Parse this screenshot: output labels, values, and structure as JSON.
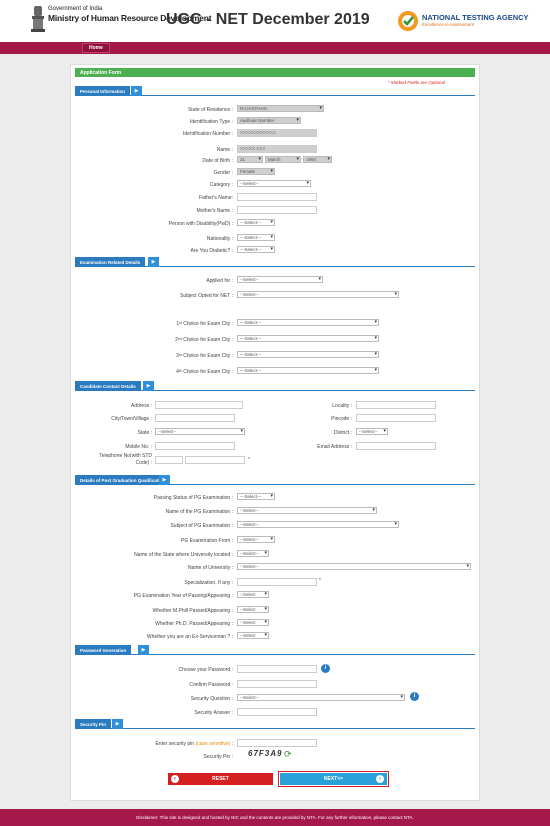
{
  "header": {
    "gov_line1": "Government of India",
    "gov_line2": "Ministry of Human Resource Development",
    "title": "UGC - NET December 2019",
    "nta_title": "NATIONAL TESTING AGENCY",
    "nta_tagline": "Excellence in Assessment"
  },
  "nav": {
    "home": "Home"
  },
  "form": {
    "title": "Application Form",
    "mandatory_note": "* Marked Fields are Optional"
  },
  "sections": {
    "personal": "Personal Information",
    "exam": "Examination Related Details",
    "contact": "Candidate Contact Details",
    "pg": "Details of Post Graduation Qualification",
    "password": "Password Generation",
    "pin": "Security Pin"
  },
  "personal": {
    "state_label": "State of Residence :",
    "state_value": "RAJASTHAN",
    "idtype_label": "Identification Type :",
    "idtype_value": "Aadhaar Number",
    "idnum_label": "Identification Number :",
    "idnum_value": "XXXXXXXXXXXX",
    "name_label": "Name :",
    "name_value": "XXXXX XXX",
    "dob_label": "Date of Birth :",
    "dob_day": "31",
    "dob_month": "March",
    "dob_year": "1994",
    "gender_label": "Gender :",
    "gender_value": "Female",
    "category_label": "Category :",
    "category_value": "--Select--",
    "father_label": "Father's Name:",
    "mother_label": "Mother's Name :",
    "pwd_label": "Person with Disability(PwD) :",
    "pwd_value": "---Select---",
    "nationality_label": "Nationality :",
    "nationality_value": "---Select---",
    "diabetic_label": "Are You Diabetic? :",
    "diabetic_value": "---Select---"
  },
  "exam": {
    "applied_label": "Applied for :",
    "applied_value": "--Select--",
    "subject_label": "Subject Opted for NET :",
    "subject_value": "--Select--",
    "choice1": "Choice for Exam City :",
    "choice2": "Choice for Exam City :",
    "choice3": "Choice for Exam City :",
    "choice4": "Choice for Exam City :",
    "n1": "1",
    "n2": "2",
    "n3": "3",
    "n4": "4",
    "sup1": "st",
    "sup2": "nd",
    "sup3": "rd",
    "sup4": "th",
    "city_value": "---Select---"
  },
  "contact": {
    "address_label": "Address :",
    "locality_label": "Locality :",
    "city_label": "City/Town/Village :",
    "pincode_label": "Pincode :",
    "state_label": "State :",
    "state_value": "--Select--",
    "district_label": "District :",
    "district_value": "--Select--",
    "mobile_label": "Mobile No. :",
    "email_label": "Email Address :",
    "tel_label1": "Telephone No(with STD",
    "tel_label2": "Code) :"
  },
  "pg": {
    "status_label": "Passing Status of PG Examination :",
    "status_value": "---Select---",
    "name_label": "Name of the PG Examination :",
    "name_value": "--Select--",
    "subject_label": "Subject of PG Examination :",
    "subject_value": "--Select--",
    "from_label": "PG Examination From :",
    "from_value": "--Select--",
    "univstate_label": "Name of the State where University located :",
    "univstate_value": "--Select--",
    "univ_label": "Name of University :",
    "univ_value": "--Select--",
    "spec_label": "Specialization, If any :",
    "year_label": "PG Examination Year of Passing/Appearing :",
    "year_value": "--Select",
    "mphil_label": "Whether M.Phill Passed/Appearing :",
    "mphil_value": "--Select",
    "phd_label": "Whether Ph.D. Passed/Appearing :",
    "phd_value": "--Select",
    "ex_label": "Whether you are an Ex-Serviceman ? :",
    "ex_value": "--Select"
  },
  "password": {
    "choose_label": "Choose your Password :",
    "confirm_label": "Confirm Password :",
    "question_label": "Security Question :",
    "question_value": "--Select--",
    "answer_label": "Security Answer :"
  },
  "pin": {
    "enter_label": "Enter security pin ",
    "case_note": "(case sensitive)",
    "enter_colon": " :",
    "pin_label": "Security Pin :",
    "captcha": "67F3A9"
  },
  "buttons": {
    "reset": "RESET",
    "next": "NEXT>>"
  },
  "footer": "Disclaimer: This site is designed and hosted by NIC and the contents are provided by NTA. For any further information, please contact NTA.",
  "colors": {
    "header_band": "#a4184a",
    "form_title": "#4caf50",
    "section": "#2a7bbf",
    "reset": "#d42020",
    "next": "#2aa0d8"
  }
}
